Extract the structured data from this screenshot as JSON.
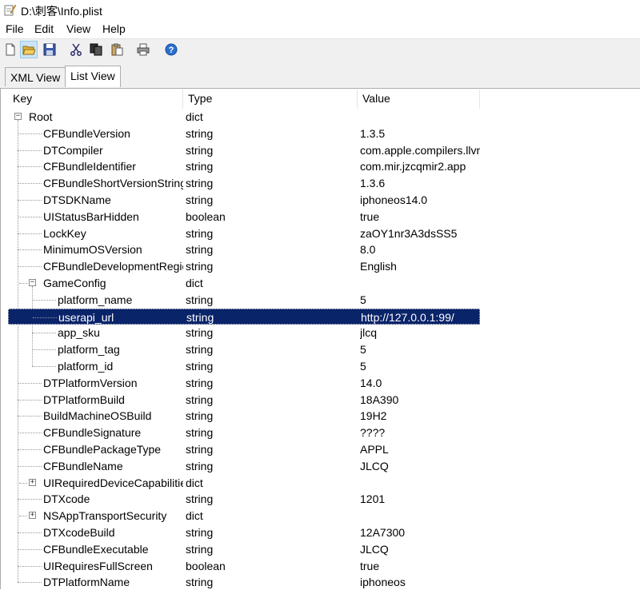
{
  "window": {
    "title": "D:\\刺客\\Info.plist",
    "icon": "notepad-pencil-icon"
  },
  "menu": [
    "File",
    "Edit",
    "View",
    "Help"
  ],
  "toolbar": {
    "buttons": [
      "new-file-icon",
      "open-folder-icon",
      "save-icon",
      "cut-icon",
      "copy-icon",
      "paste-icon",
      "print-icon",
      "help-icon"
    ]
  },
  "tabs": [
    {
      "label": "XML View",
      "selected": false
    },
    {
      "label": "List View",
      "selected": true
    }
  ],
  "columns": [
    "Key",
    "Type",
    "Value"
  ],
  "rows": [
    {
      "key": "Root",
      "type": "dict",
      "value": "",
      "depth": 0,
      "expander": "minus"
    },
    {
      "key": "CFBundleVersion",
      "type": "string",
      "value": "1.3.5",
      "depth": 1
    },
    {
      "key": "DTCompiler",
      "type": "string",
      "value": "com.apple.compilers.llvm",
      "depth": 1
    },
    {
      "key": "CFBundleIdentifier",
      "type": "string",
      "value": "com.mir.jzcqmir2.app",
      "depth": 1
    },
    {
      "key": "CFBundleShortVersionString",
      "type": "string",
      "value": "1.3.6",
      "depth": 1
    },
    {
      "key": "DTSDKName",
      "type": "string",
      "value": "iphoneos14.0",
      "depth": 1
    },
    {
      "key": "UIStatusBarHidden",
      "type": "boolean",
      "value": "true",
      "depth": 1
    },
    {
      "key": "LockKey",
      "type": "string",
      "value": "zaOY1nr3A3dsSS5",
      "depth": 1
    },
    {
      "key": "MinimumOSVersion",
      "type": "string",
      "value": "8.0",
      "depth": 1
    },
    {
      "key": "CFBundleDevelopmentRegion",
      "type": "string",
      "value": "English",
      "depth": 1
    },
    {
      "key": "GameConfig",
      "type": "dict",
      "value": "",
      "depth": 1,
      "expander": "minus"
    },
    {
      "key": "platform_name",
      "type": "string",
      "value": "5",
      "depth": 2
    },
    {
      "key": "userapi_url",
      "type": "string",
      "value": "http://127.0.0.1:99/",
      "depth": 2,
      "selected": true
    },
    {
      "key": "app_sku",
      "type": "string",
      "value": "jlcq",
      "depth": 2
    },
    {
      "key": "platform_tag",
      "type": "string",
      "value": "5",
      "depth": 2
    },
    {
      "key": "platform_id",
      "type": "string",
      "value": "5",
      "depth": 2
    },
    {
      "key": "DTPlatformVersion",
      "type": "string",
      "value": "14.0",
      "depth": 1
    },
    {
      "key": "DTPlatformBuild",
      "type": "string",
      "value": "18A390",
      "depth": 1
    },
    {
      "key": "BuildMachineOSBuild",
      "type": "string",
      "value": "19H2",
      "depth": 1
    },
    {
      "key": "CFBundleSignature",
      "type": "string",
      "value": "????",
      "depth": 1
    },
    {
      "key": "CFBundlePackageType",
      "type": "string",
      "value": "APPL",
      "depth": 1
    },
    {
      "key": "CFBundleName",
      "type": "string",
      "value": "JLCQ",
      "depth": 1
    },
    {
      "key": "UIRequiredDeviceCapabilities",
      "type": "dict",
      "value": "",
      "depth": 1,
      "expander": "plus"
    },
    {
      "key": "DTXcode",
      "type": "string",
      "value": "1201",
      "depth": 1
    },
    {
      "key": "NSAppTransportSecurity",
      "type": "dict",
      "value": "",
      "depth": 1,
      "expander": "plus"
    },
    {
      "key": "DTXcodeBuild",
      "type": "string",
      "value": "12A7300",
      "depth": 1
    },
    {
      "key": "CFBundleExecutable",
      "type": "string",
      "value": "JLCQ",
      "depth": 1
    },
    {
      "key": "UIRequiresFullScreen",
      "type": "boolean",
      "value": "true",
      "depth": 1
    },
    {
      "key": "DTPlatformName",
      "type": "string",
      "value": "iphoneos",
      "depth": 1
    }
  ]
}
